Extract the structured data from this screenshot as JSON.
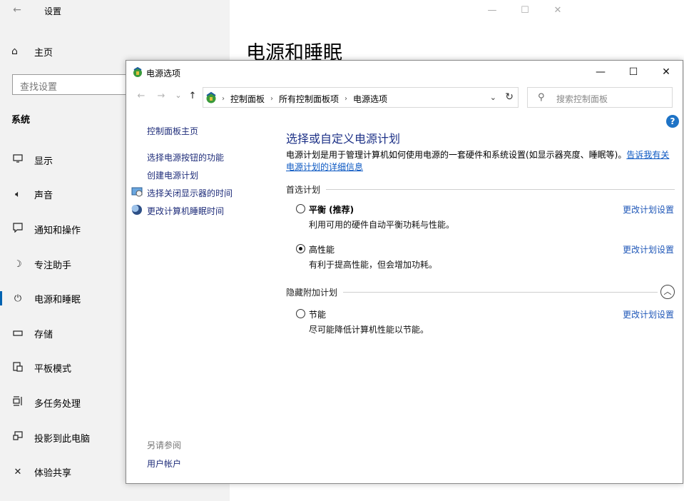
{
  "settings": {
    "title": "设置",
    "home_label": "主页",
    "search_placeholder": "查找设置",
    "section_title": "系统",
    "page_title": "电源和睡眠",
    "nav": [
      {
        "label": "显示",
        "icon": "monitor-icon"
      },
      {
        "label": "声音",
        "icon": "speaker-icon"
      },
      {
        "label": "通知和操作",
        "icon": "notification-icon"
      },
      {
        "label": "专注助手",
        "icon": "moon-icon"
      },
      {
        "label": "电源和睡眠",
        "icon": "power-icon",
        "active": true
      },
      {
        "label": "存储",
        "icon": "storage-icon"
      },
      {
        "label": "平板模式",
        "icon": "tablet-icon"
      },
      {
        "label": "多任务处理",
        "icon": "multitask-icon"
      },
      {
        "label": "投影到此电脑",
        "icon": "project-icon"
      },
      {
        "label": "体验共享",
        "icon": "share-icon"
      }
    ]
  },
  "power": {
    "title": "电源选项",
    "breadcrumbs": [
      "控制面板",
      "所有控制面板项",
      "电源选项"
    ],
    "search_placeholder": "搜索控制面板",
    "left_links": {
      "home": "控制面板主页",
      "power_buttons": "选择电源按钮的功能",
      "create_plan": "创建电源计划",
      "display_off": "选择关闭显示器的时间",
      "sleep": "更改计算机睡眠时间"
    },
    "see_also": "另请参阅",
    "user_accounts": "用户帐户",
    "heading": "选择或自定义电源计划",
    "description": "电源计划是用于管理计算机如何使用电源的一套硬件和系统设置(如显示器亮度、睡眠等)。",
    "description_link": "告诉我有关电源计划的详细信息",
    "preferred_label": "首选计划",
    "hidden_label": "隐藏附加计划",
    "plans": [
      {
        "name": "平衡 (推荐)",
        "desc": "利用可用的硬件自动平衡功耗与性能。",
        "checked": false,
        "bold": true
      },
      {
        "name": "高性能",
        "desc": "有利于提高性能，但会增加功耗。",
        "checked": true,
        "bold": false
      },
      {
        "name": "节能",
        "desc": "尽可能降低计算机性能以节能。",
        "checked": false,
        "bold": false
      }
    ],
    "edit_label": "更改计划设置"
  }
}
